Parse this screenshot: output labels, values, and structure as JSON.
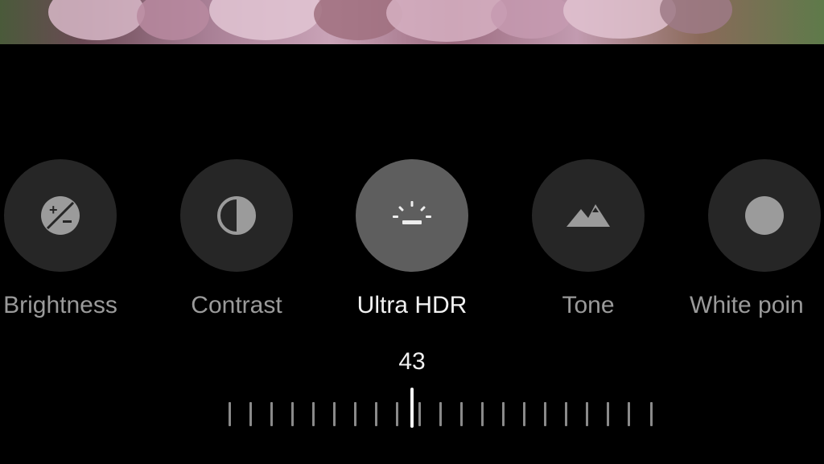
{
  "tools": [
    {
      "id": "brightness",
      "label": "Brightness",
      "icon": "brightness-icon",
      "active": false
    },
    {
      "id": "contrast",
      "label": "Contrast",
      "icon": "contrast-icon",
      "active": false
    },
    {
      "id": "ultra-hdr",
      "label": "Ultra HDR",
      "icon": "ultra-hdr-icon",
      "active": true
    },
    {
      "id": "tone",
      "label": "Tone",
      "icon": "mountain-icon",
      "active": false
    },
    {
      "id": "white-point",
      "label": "White poin",
      "icon": "circle-icon",
      "active": false
    }
  ],
  "slider": {
    "value": "43"
  },
  "colors": {
    "background": "#000000",
    "button": "#262626",
    "button_active": "#5e5e5e",
    "label": "#9a9a9a",
    "label_active": "#f2f2f2"
  }
}
